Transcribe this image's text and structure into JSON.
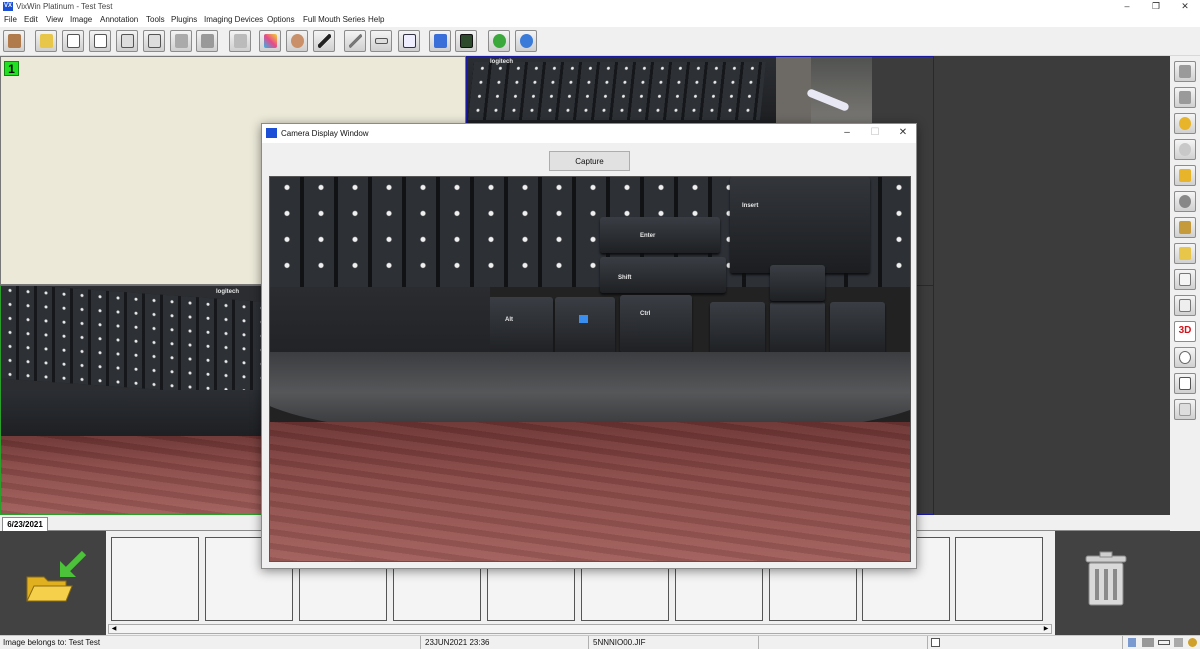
{
  "window": {
    "title": "VixWin Platinum - Test Test",
    "app_icon_text": "VX",
    "minimize": "–",
    "restore": "❐",
    "close": "✕"
  },
  "menu": [
    "File",
    "Edit",
    "View",
    "Image",
    "Annotation",
    "Tools",
    "Plugins",
    "Imaging Devices",
    "Options",
    "Full Mouth Series",
    "Help"
  ],
  "toolbar": {
    "buttons": [
      "patient-icon",
      "open-folder-icon",
      "document-icon",
      "copy-icon",
      "paste-icon",
      "multi-page-icon",
      "email-icon",
      "print-icon",
      "eraser-icon",
      "color-filter-icon",
      "face-icon",
      "pen-icon",
      "line-icon",
      "ruler-icon",
      "text-annotation-icon",
      "window-icon",
      "calculator-icon",
      "help-icon",
      "info-icon"
    ]
  },
  "workspace": {
    "slot1_label": "1",
    "photo_brand": "logitech"
  },
  "right_tools": [
    "rotate-left-icon",
    "rotate-right-icon",
    "zoom-in-icon",
    "zoom-out-icon",
    "zoom-window-icon",
    "brightness-icon",
    "contrast-icon",
    "enhance-icon",
    "tooth-icon",
    "tooth-implant-icon",
    "3d-icon",
    "speech-bubble-icon",
    "book-icon",
    "tooth-outline-icon"
  ],
  "right_tool_3d_label": "3D",
  "date_tab": "6/23/2021",
  "status": {
    "owner": "Image belongs to: Test Test",
    "datetime": "23JUN2021 23:36",
    "filename": "5NNNIO00.JIF"
  },
  "camera_window": {
    "title": "Camera Display Window",
    "capture_label": "Capture",
    "minimize": "–",
    "maximize": "☐",
    "close": "✕",
    "key_labels": {
      "enter": "Enter",
      "shift": "Shift",
      "ctrl": "Ctrl",
      "alt": "Alt",
      "insert": "Insert"
    }
  },
  "colors": {
    "slot_number": "#22e022",
    "trash_bg": "#424242",
    "app_icon": "#1a4fd6",
    "threed_label": "#d0121b"
  }
}
